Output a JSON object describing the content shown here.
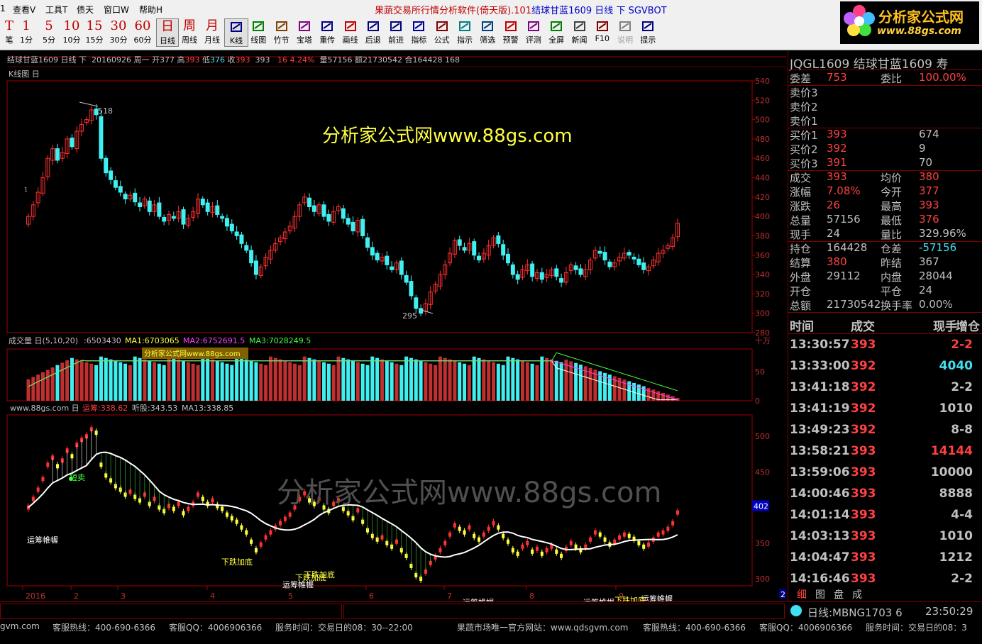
{
  "menu": {
    "items": [
      "查看V",
      "工具T",
      "债天",
      "窗口W",
      "帮助H"
    ],
    "app_title": "果蔬交易所行情分析软件(倚天版).101",
    "app_title_sub": "结球甘蓝1609 日线 下 SGVBOT"
  },
  "toolbar": {
    "period_buttons": [
      {
        "top": "T",
        "label": "笔"
      },
      {
        "top": "1",
        "label": "1分"
      },
      {
        "top": "5",
        "label": "5分"
      },
      {
        "top": "10",
        "label": "10分"
      },
      {
        "top": "15",
        "label": "15分"
      },
      {
        "top": "30",
        "label": "30分"
      },
      {
        "top": "60",
        "label": "60分"
      },
      {
        "top": "日",
        "label": "日线"
      },
      {
        "top": "周",
        "label": "周线"
      },
      {
        "top": "月",
        "label": "月线"
      }
    ],
    "tool_buttons": [
      "K线",
      "线图",
      "竹节",
      "宝塔",
      "重传",
      "画线",
      "后退",
      "前进",
      "指标",
      "公式",
      "指示",
      "筛选",
      "预警",
      "评测",
      "全屏",
      "新闻",
      "F10",
      "说明",
      "提示"
    ]
  },
  "logo": {
    "line1": "分析家公式网",
    "line2": "www.88gs.com"
  },
  "info_line": {
    "name": "结球甘蓝1609 日线 下",
    "date": "20160926 周一",
    "open_label": "开",
    "open": "377",
    "high_label": "高",
    "high": "393",
    "low_label": "低",
    "low": "376",
    "close_label": "收",
    "close": "393",
    "settle": "393",
    "change": "16",
    "change_pct": "4.24%",
    "volume": "量57156",
    "amount": "额21730542",
    "position": "合164428",
    "extra": "168"
  },
  "kline_chart": {
    "label": "K线图 日",
    "watermark": "分析家公式网www.88gs.com",
    "y_ticks": [
      "540",
      "520",
      "500",
      "480",
      "460",
      "440",
      "420",
      "400",
      "380",
      "360",
      "340",
      "320",
      "300",
      "280"
    ],
    "high_marker": "518",
    "low_marker": "295",
    "small_marker": "1"
  },
  "volume_chart": {
    "label": "成交量 日(5,10,20)",
    "value": ":6503430",
    "ma1": "MA1:6703065",
    "ma2": "MA2:6752691.5",
    "ma3": "MA3:7028249.5",
    "watermark": "分析家公式网www.88gs.com",
    "y_ticks": [
      "十万",
      "50",
      "0"
    ]
  },
  "indicator_chart": {
    "label": "www.88gs.com 日",
    "yunchou": "运筹:338.62",
    "tinggu": "听股:343.53",
    "ma13": "MA13:338.85",
    "watermark": "分析家公式网www.88gs.com",
    "y_ticks": [
      "500",
      "450",
      "350",
      "300"
    ],
    "current_value_box": "402",
    "annotations": [
      {
        "text": "短卖",
        "color": "#40ff40"
      },
      {
        "text": "运筹帷幄",
        "color": "#ffffff"
      },
      {
        "text": "运筹帷幄",
        "color": "#ffffff"
      },
      {
        "text": "运筹帷幄",
        "color": "#ffffff"
      },
      {
        "text": "运筹帷幄",
        "color": "#ffffff"
      },
      {
        "text": "运筹帷幄",
        "color": "#ffffff"
      },
      {
        "text": "下跌加底",
        "color": "#ffff40"
      },
      {
        "text": "下跌加底",
        "color": "#ffff40"
      },
      {
        "text": "下跌加底",
        "color": "#ffff40"
      },
      {
        "text": "下跌加底",
        "color": "#ffff40"
      }
    ]
  },
  "x_axis": {
    "labels": [
      "2016",
      "2",
      "3",
      "4",
      "5",
      "6",
      "7",
      "8",
      "9"
    ],
    "edge_label": "2"
  },
  "quote_panel": {
    "title": "JQGL1609 结球甘蓝1609",
    "title_suffix": "寿",
    "weicha_label": "委差",
    "weicha": "753",
    "weibi_label": "委比",
    "weibi": "100.00%",
    "asks": [
      {
        "label": "卖价3",
        "price": "",
        "vol": ""
      },
      {
        "label": "卖价2",
        "price": "",
        "vol": ""
      },
      {
        "label": "卖价1",
        "price": "",
        "vol": ""
      }
    ],
    "bids": [
      {
        "label": "买价1",
        "price": "393",
        "vol": "674"
      },
      {
        "label": "买价2",
        "price": "392",
        "vol": "9"
      },
      {
        "label": "买价3",
        "price": "391",
        "vol": "70"
      }
    ],
    "stats": [
      {
        "l1": "成交",
        "v1": "393",
        "c1": "#ff4040",
        "l2": "均价",
        "v2": "380",
        "c2": "#ff4040"
      },
      {
        "l1": "涨幅",
        "v1": "7.08%",
        "c1": "#ff4040",
        "l2": "今开",
        "v2": "377",
        "c2": "#ff4040"
      },
      {
        "l1": "涨跌",
        "v1": "26",
        "c1": "#ff4040",
        "l2": "最高",
        "v2": "393",
        "c2": "#ff4040"
      },
      {
        "l1": "总量",
        "v1": "57156",
        "c1": "#c0c0c0",
        "l2": "最低",
        "v2": "376",
        "c2": "#ff4040"
      },
      {
        "l1": "现手",
        "v1": "24",
        "c1": "#c0c0c0",
        "l2": "量比",
        "v2": "329.96%",
        "c2": "#c0c0c0"
      }
    ],
    "stats2": [
      {
        "l1": "持仓",
        "v1": "164428",
        "c1": "#c0c0c0",
        "l2": "仓差",
        "v2": "-57156",
        "c2": "#40e0f0"
      },
      {
        "l1": "结算",
        "v1": "380",
        "c1": "#ff4040",
        "l2": "昨结",
        "v2": "367",
        "c2": "#c0c0c0"
      },
      {
        "l1": "外盘",
        "v1": "29112",
        "c1": "#c0c0c0",
        "l2": "内盘",
        "v2": "28044",
        "c2": "#c0c0c0"
      },
      {
        "l1": "开仓",
        "v1": "",
        "c1": "#c0c0c0",
        "l2": "平仓",
        "v2": "24",
        "c2": "#c0c0c0"
      },
      {
        "l1": "总额",
        "v1": "21730542",
        "c1": "#c0c0c0",
        "l2": "换手率",
        "v2": "0.00%",
        "c2": "#c0c0c0"
      }
    ],
    "ticks_header": {
      "time": "时间",
      "deal": "成交",
      "cur": "现手",
      "pos": "增仓"
    },
    "ticks": [
      {
        "time": "13:30:57",
        "price": "393",
        "vol": "2-2",
        "vc": "#ff4040"
      },
      {
        "time": "13:33:00",
        "price": "392",
        "vol": "4040",
        "vc": "#40e0f0"
      },
      {
        "time": "13:41:18",
        "price": "392",
        "vol": "2-2",
        "vc": "#c0c0c0"
      },
      {
        "time": "13:41:19",
        "price": "392",
        "vol": "1010",
        "vc": "#c0c0c0"
      },
      {
        "time": "13:49:23",
        "price": "392",
        "vol": "8-8",
        "vc": "#c0c0c0"
      },
      {
        "time": "13:58:21",
        "price": "393",
        "vol": "14144",
        "vc": "#ff4040"
      },
      {
        "time": "13:59:06",
        "price": "393",
        "vol": "10000",
        "vc": "#c0c0c0"
      },
      {
        "time": "14:00:46",
        "price": "393",
        "vol": "8888",
        "vc": "#c0c0c0"
      },
      {
        "time": "14:01:14",
        "price": "393",
        "vol": "4-4",
        "vc": "#c0c0c0"
      },
      {
        "time": "14:03:13",
        "price": "393",
        "vol": "1010",
        "vc": "#c0c0c0"
      },
      {
        "time": "14:04:47",
        "price": "393",
        "vol": "1212",
        "vc": "#c0c0c0"
      },
      {
        "time": "14:16:46",
        "price": "393",
        "vol": "2-2",
        "vc": "#c0c0c0"
      }
    ],
    "tabs": [
      "细",
      "图",
      "盘",
      "成"
    ]
  },
  "status_bar": {
    "day_line": "日线:MBNG1703 6",
    "clock": "23:50:29"
  },
  "footer": {
    "items": [
      "gvm.com",
      "客服热线：400-690-6366",
      "客服QQ：4006906366",
      "服务时间：交易日的08：30--22:00",
      "果蔬市场唯一官方网站：www.qdsgvm.com",
      "客服热线：400-690-6366",
      "客服QQ：4006906366",
      "服务时间：交易日的08：3"
    ]
  },
  "chart_data": [
    {
      "type": "candlestick",
      "title": "K线图 日",
      "ylim": [
        280,
        540
      ],
      "colors": {
        "up": "#ff3030",
        "down": "#40f0f0"
      },
      "closes": [
        400,
        412,
        425,
        440,
        460,
        470,
        458,
        466,
        480,
        472,
        488,
        495,
        500,
        510,
        505,
        460,
        445,
        438,
        430,
        425,
        418,
        422,
        415,
        410,
        418,
        405,
        412,
        400,
        395,
        402,
        398,
        405,
        392,
        398,
        405,
        418,
        412,
        405,
        410,
        402,
        398,
        390,
        385,
        380,
        372,
        365,
        352,
        340,
        348,
        358,
        365,
        372,
        378,
        384,
        390,
        400,
        412,
        420,
        410,
        405,
        412,
        400,
        395,
        405,
        410,
        398,
        392,
        385,
        396,
        380,
        368,
        360,
        355,
        358,
        350,
        345,
        352,
        340,
        332,
        318,
        305,
        300,
        310,
        322,
        330,
        340,
        350,
        362,
        375,
        370,
        365,
        372,
        360,
        355,
        362,
        370,
        378,
        372,
        360,
        352,
        340,
        335,
        345,
        350,
        338,
        342,
        335,
        340,
        345,
        338,
        332,
        342,
        350,
        345,
        340,
        345,
        355,
        365,
        362,
        355,
        348,
        352,
        358,
        362,
        360,
        356,
        350,
        345,
        348,
        355,
        362,
        365,
        370,
        378,
        393
      ]
    },
    {
      "type": "bar",
      "title": "成交量 日(5,10,20)",
      "ylabel": "十万",
      "ylim": [
        0,
        70
      ],
      "value_count": 135,
      "colors": {
        "up": "#c03030",
        "down": "#40f0f0",
        "ma1": "#ffffff",
        "ma2": "#ff40ff",
        "ma3": "#40ff40"
      }
    },
    {
      "type": "line",
      "title": "www.88gs.com 日",
      "ylim": [
        290,
        530
      ],
      "series": [
        {
          "name": "运筹",
          "color": "#ff4040"
        },
        {
          "name": "听股",
          "color": "#ffff40"
        },
        {
          "name": "MA13",
          "color": "#ffffff"
        }
      ]
    }
  ]
}
